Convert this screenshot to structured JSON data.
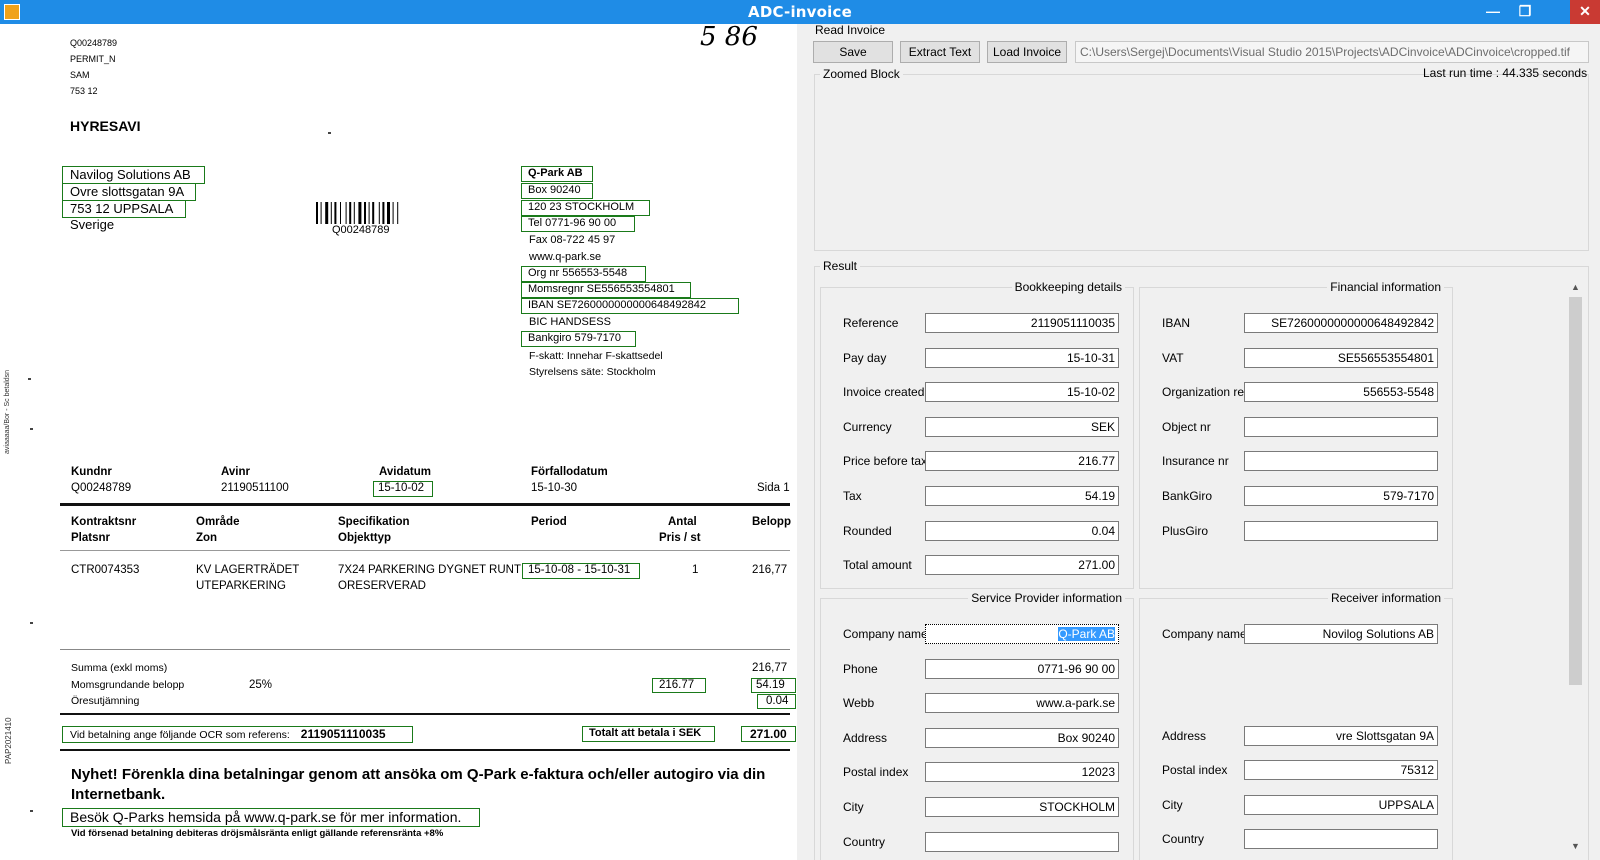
{
  "window": {
    "title": "ADC-invoice",
    "min": "—",
    "max": "❐",
    "close": "✕"
  },
  "doc": {
    "ref_block": [
      "Q00248789",
      "PERMIT_N",
      "SAM",
      "753 12"
    ],
    "handwritten": "5 86",
    "hyresavi": "HYRESAVI",
    "sender": [
      "Navilog Solutions AB",
      "Ovre slottsgatan 9A",
      "753 12 UPPSALA",
      "Sverige"
    ],
    "barcode_number": "Q00248789",
    "provider": [
      "Q-Park AB",
      "Box 90240",
      "120 23 STOCKHOLM",
      "Tel 0771-96 90 00",
      "Fax 08-722 45 97",
      "www.q-park.se",
      "Org nr 556553-5548",
      "Momsregnr SE556553554801",
      "IBAN SE7260000000000648492842",
      "BIC HANDSESS",
      "Bankgiro 579-7170",
      "F-skatt: Innehar F-skattsedel",
      "Styrelsens säte: Stockholm"
    ],
    "side_text_1": "aviaaaaa/Bor - Sc betaldsn",
    "side_text_2": "PAP2021410",
    "h1": {
      "kundnr": "Kundnr",
      "avinr": "Avinr",
      "avidatum": "Avidatum",
      "forfallodatum": "Förfallodatum"
    },
    "v1": {
      "kundnr": "Q00248789",
      "avinr": "21190511100",
      "avidatum": "15-10-02",
      "forfallodatum": "15-10-30",
      "sida": "Sida 1"
    },
    "h2": {
      "kontrakt": "Kontraktsnr",
      "plats": "Platsnr",
      "omrade": "Område",
      "zon": "Zon",
      "spec": "Specifikation",
      "objekttyp": "Objekttyp",
      "period": "Period",
      "antal": "Antal",
      "pris": "Pris / st",
      "belopp": "Belopp"
    },
    "line": {
      "kontrakt": "CTR0074353",
      "omrade1": "KV LAGERTRÄDET",
      "omrade2": "UTEPARKERING",
      "spec1": "7X24 PARKERING DYGNET RUNT",
      "spec2": "ORESERVERAD",
      "period": "15-10-08 - 15-10-31",
      "antal": "1",
      "belopp": "216,77"
    },
    "summa": {
      "label": "Summa (exkl moms)",
      "value": "216,77"
    },
    "moms": {
      "label": "Momsgrundande belopp",
      "pct": "25%",
      "base": "216.77",
      "value": "54.19"
    },
    "ores": {
      "label": "Öresutjämning",
      "value": "0.04"
    },
    "ocr": {
      "label": "Vid betalning ange följande OCR som referens:",
      "value": "2119051110035"
    },
    "total": {
      "label": "Totalt att betala i SEK",
      "value": "271.00"
    },
    "news1": "Nyhet! Förenkla dina betalningar genom att ansöka om Q-Park e-faktura och/eller autogiro via din",
    "news2": "Internetbank.",
    "news3": "Besök Q-Parks hemsida på www.q-park.se för mer information.",
    "footer": "Vid försenad betalning debiteras dröjsmålsränta enligt gällande referensränta +8%"
  },
  "panel": {
    "read_invoice": "Read Invoice",
    "save": "Save",
    "extract": "Extract Text",
    "load": "Load Invoice",
    "path": "C:\\Users\\Sergej\\Documents\\Visual Studio 2015\\Projects\\ADCinvoice\\ADCinvoice\\cropped.tif",
    "zoomed": "Zoomed Block",
    "runtime": "Last run time : 44.335 seconds",
    "result": "Result",
    "bookkeeping": {
      "title": "Bookkeeping details",
      "rows": [
        {
          "label": "Reference",
          "value": "2119051110035"
        },
        {
          "label": "Pay day",
          "value": "15-10-31"
        },
        {
          "label": "Invoice created",
          "value": "15-10-02"
        },
        {
          "label": "Currency",
          "value": "SEK"
        },
        {
          "label": "Price before tax",
          "value": "216.77"
        },
        {
          "label": "Tax",
          "value": "54.19"
        },
        {
          "label": "Rounded",
          "value": "0.04"
        },
        {
          "label": "Total amount",
          "value": "271.00"
        }
      ]
    },
    "financial": {
      "title": "Financial information",
      "rows": [
        {
          "label": "IBAN",
          "value": "SE7260000000000648492842"
        },
        {
          "label": "VAT",
          "value": "SE556553554801"
        },
        {
          "label": "Organization ref",
          "value": "556553-5548"
        },
        {
          "label": "Object nr",
          "value": ""
        },
        {
          "label": "Insurance nr",
          "value": ""
        },
        {
          "label": "BankGiro",
          "value": "579-7170"
        },
        {
          "label": "PlusGiro",
          "value": ""
        }
      ]
    },
    "service": {
      "title": "Service Provider information",
      "rows": [
        {
          "label": "Company name",
          "value": "Q-Park AB"
        },
        {
          "label": "Phone",
          "value": "0771-96 90 00"
        },
        {
          "label": "Webb",
          "value": "www.a-park.se"
        },
        {
          "label": "Address",
          "value": "Box 90240"
        },
        {
          "label": "Postal index",
          "value": "12023"
        },
        {
          "label": "City",
          "value": "STOCKHOLM"
        },
        {
          "label": "Country",
          "value": ""
        }
      ]
    },
    "receiver": {
      "title": "Receiver information",
      "rows": [
        {
          "label": "Company name",
          "value": "Novilog Solutions AB"
        },
        {
          "label": "Address",
          "value": "vre Slottsgatan 9A"
        },
        {
          "label": "Postal index",
          "value": "75312"
        },
        {
          "label": "City",
          "value": "UPPSALA"
        },
        {
          "label": "Country",
          "value": ""
        }
      ]
    }
  }
}
